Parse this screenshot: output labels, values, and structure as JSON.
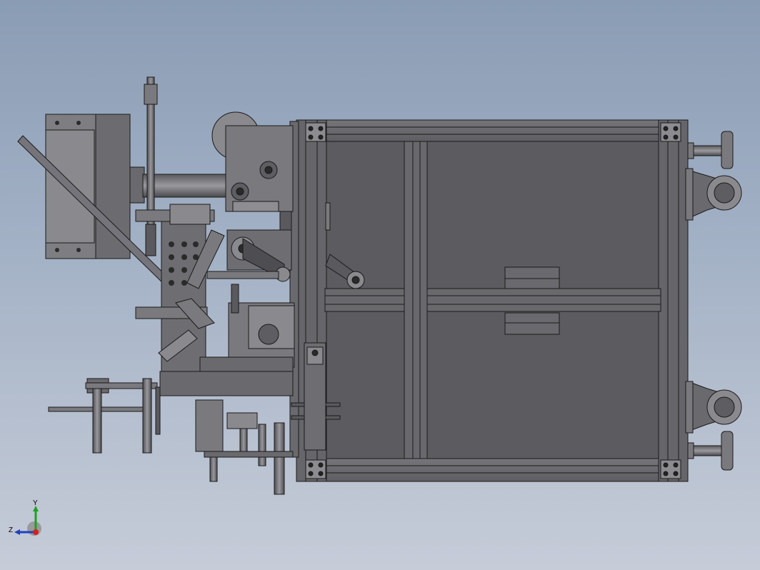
{
  "triad": {
    "y_label": "Y",
    "z_label": "Z",
    "x_color": "#d42020",
    "y_color": "#20a020",
    "z_color": "#2040c0"
  },
  "colors": {
    "background_top": "#8a9cb4",
    "background_bottom": "#c6ccd8",
    "part_fill": "#6e6e72",
    "part_light": "#8c8c90",
    "edge": "#1a1a1a"
  }
}
